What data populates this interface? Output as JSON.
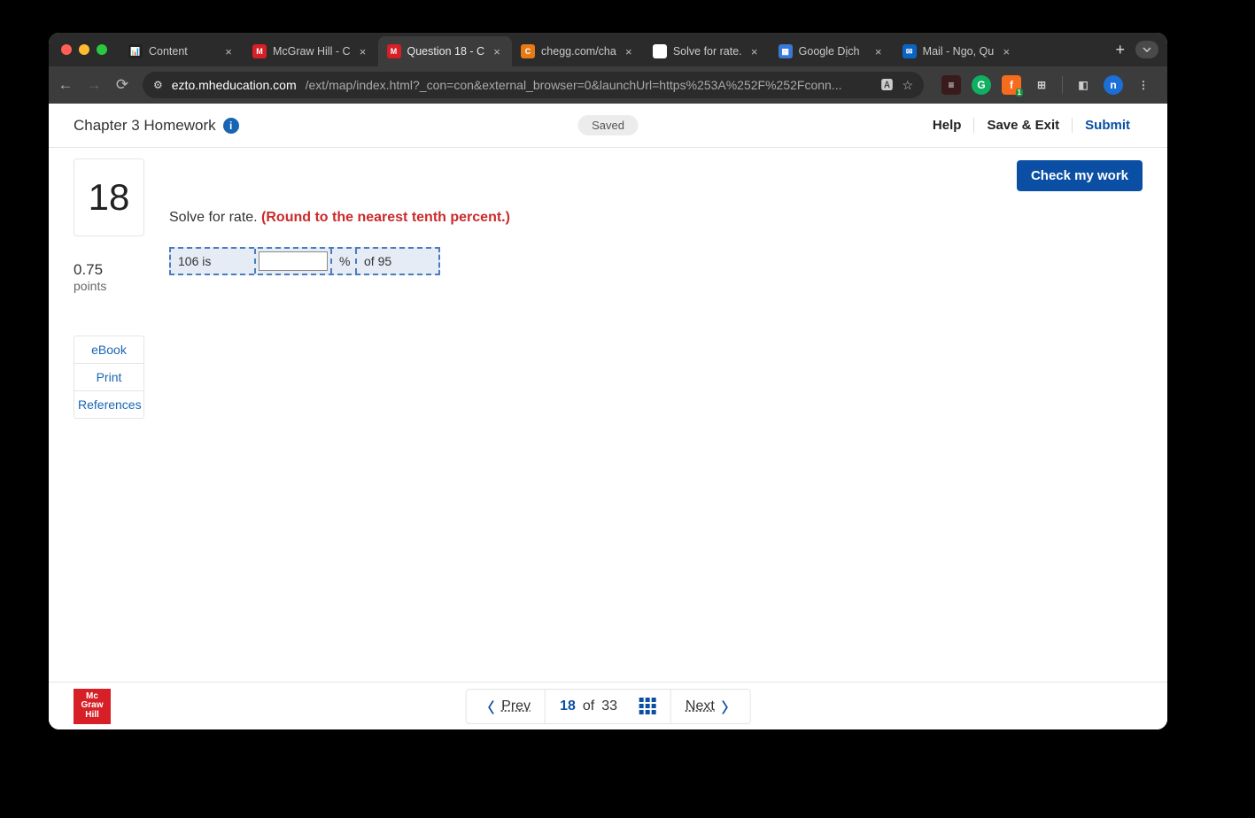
{
  "browser": {
    "tabs": [
      {
        "favbg": "#222",
        "favtxt": "📊",
        "title": "Content"
      },
      {
        "favbg": "#d61f26",
        "favtxt": "M",
        "title": "McGraw Hill - C"
      },
      {
        "favbg": "#d61f26",
        "favtxt": "M",
        "title": "Question 18 - C",
        "active": true
      },
      {
        "favbg": "#e67a17",
        "favtxt": "C",
        "title": "chegg.com/cha"
      },
      {
        "favbg": "#fff",
        "favtxt": "G",
        "title": "Solve for rate."
      },
      {
        "favbg": "#3878d6",
        "favtxt": "▦",
        "title": "Google Dịch"
      },
      {
        "favbg": "#0a64c2",
        "favtxt": "✉",
        "title": "Mail - Ngo, Qu"
      }
    ],
    "url_host": "ezto.mheducation.com",
    "url_path": "/ext/map/index.html?_con=con&external_browser=0&launchUrl=https%253A%252F%252Fconn..."
  },
  "header": {
    "assignment": "Chapter 3 Homework",
    "saved": "Saved",
    "help": "Help",
    "save_exit": "Save & Exit",
    "submit": "Submit"
  },
  "check": "Check my work",
  "sidebar": {
    "qnum": "18",
    "points_value": "0.75",
    "points_label": "points",
    "actions": [
      "eBook",
      "Print",
      "References"
    ]
  },
  "question": {
    "prompt": "Solve for rate. ",
    "round": "(Round to the nearest tenth percent.)",
    "cell_left": "106 is",
    "cell_pct": "%",
    "cell_right": "of 95",
    "input_value": ""
  },
  "footer": {
    "logo_l1": "Mc",
    "logo_l2": "Graw",
    "logo_l3": "Hill",
    "prev": "Prev",
    "next": "Next",
    "current": "18",
    "of": "of",
    "total": "33"
  }
}
